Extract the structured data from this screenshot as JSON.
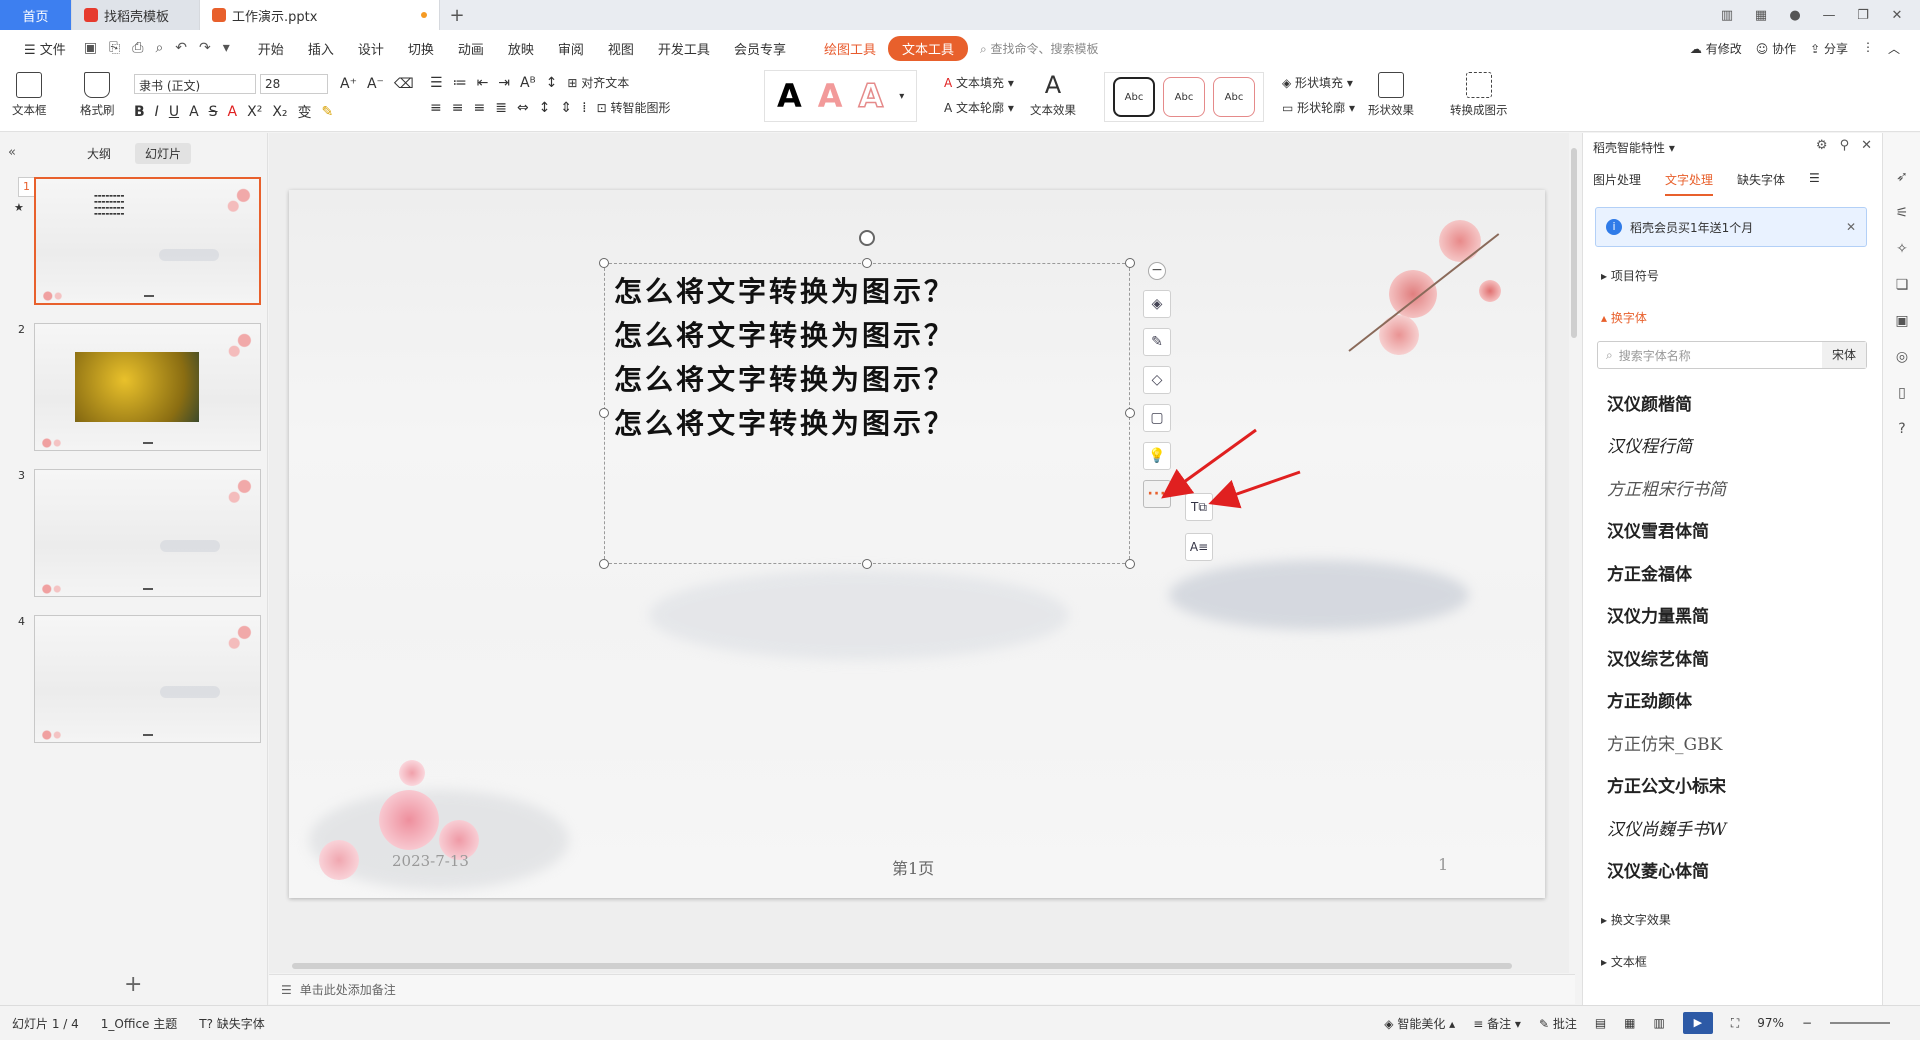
{
  "titlebar": {
    "tabs": [
      {
        "label": "首页"
      },
      {
        "label": "找稻壳模板"
      },
      {
        "label": "工作演示.pptx"
      }
    ]
  },
  "menubar": {
    "file": "文件",
    "items": [
      "开始",
      "插入",
      "设计",
      "切换",
      "动画",
      "放映",
      "审阅",
      "视图",
      "开发工具",
      "会员专享"
    ],
    "draw_tool": "绘图工具",
    "text_tool": "文本工具",
    "search_placeholder": "查找命令、搜索模板",
    "right": [
      "有修改",
      "协作",
      "分享"
    ]
  },
  "ribbon": {
    "textbox": "文本框",
    "format_painter": "格式刷",
    "font_name": "隶书 (正文)",
    "font_size": "28",
    "align_text": "对齐文本",
    "smart_shape": "转智能图形",
    "text_fill": "文本填充",
    "text_outline": "文本轮廓",
    "text_effect": "文本效果",
    "style_sample": "Abc",
    "shape_fill": "形状填充",
    "shape_outline": "形状轮廓",
    "shape_effect": "形状效果",
    "convert_diagram": "转换成图示"
  },
  "leftpanel": {
    "tabs": [
      "大纲",
      "幻灯片"
    ],
    "slides": [
      {
        "num": "1"
      },
      {
        "num": "2"
      },
      {
        "num": "3"
      },
      {
        "num": "4"
      }
    ]
  },
  "slide": {
    "lines": [
      "怎么将文字转换为图示？",
      "怎么将文字转换为图示？",
      "怎么将文字转换为图示？",
      "怎么将文字转换为图示？"
    ],
    "date": "2023-7-13",
    "page_label": "第1页",
    "number": "1"
  },
  "notes": {
    "placeholder": "单击此处添加备注"
  },
  "rightpanel": {
    "title": "稻壳智能特性",
    "tabs": [
      "图片处理",
      "文字处理",
      "缺失字体"
    ],
    "banner": "稻壳会员买1年送1个月",
    "section_bullets": "项目符号",
    "section_font": "换字体",
    "search_placeholder": "搜索字体名称",
    "current_font": "宋体",
    "fonts": [
      "汉仪颜楷简",
      "汉仪程行简",
      "方正粗宋行书简",
      "汉仪雪君体简",
      "方正金福体",
      "汉仪力量黑简",
      "汉仪综艺体简",
      "方正劲颜体",
      "方正仿宋_GBK",
      "方正公文小标宋",
      "汉仪尚巍手书W",
      "汉仪菱心体简"
    ],
    "section_text_effect": "换文字效果",
    "section_textbox": "文本框"
  },
  "statusbar": {
    "slide_count": "幻灯片 1 / 4",
    "theme": "1_Office 主题",
    "missing_font": "缺失字体",
    "smart_beautify": "智能美化",
    "notes": "备注",
    "comments": "批注",
    "zoom": "97%"
  },
  "colors": {
    "accent": "#e8602c",
    "home_tab": "#3d7ff0"
  }
}
